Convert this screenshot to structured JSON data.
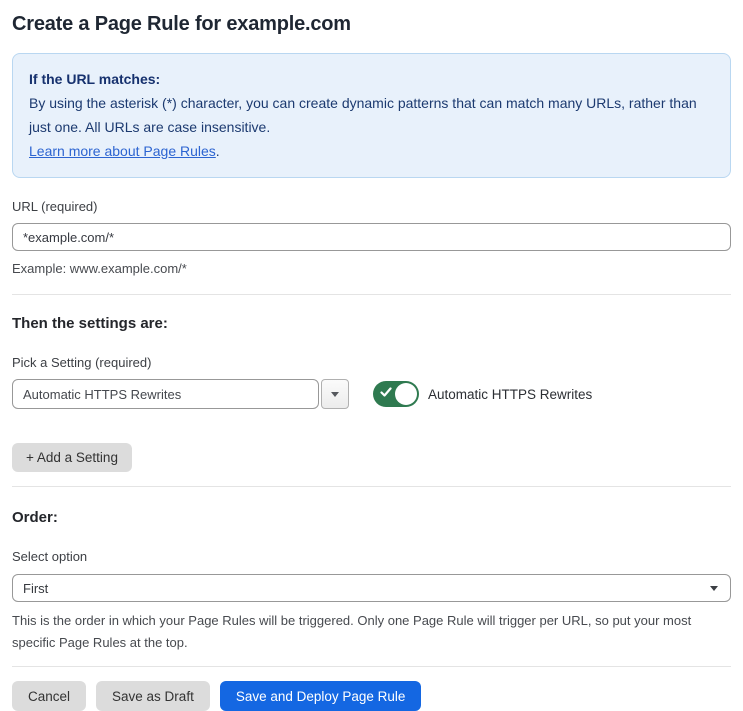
{
  "page": {
    "title": "Create a Page Rule for example.com"
  },
  "info_box": {
    "heading": "If the URL matches:",
    "body": "By using the asterisk (*) character, you can create dynamic patterns that can match many URLs, rather than just one. All URLs are case insensitive.",
    "link_label": "Learn more about Page Rules",
    "link_suffix": "."
  },
  "url_field": {
    "label": "URL (required)",
    "value": "*example.com/*",
    "helper": "Example: www.example.com/*"
  },
  "settings_section": {
    "heading": "Then the settings are:",
    "picker_label": "Pick a Setting (required)",
    "picker_value": "Automatic HTTPS Rewrites",
    "toggle": {
      "state": "on",
      "label": "Automatic HTTPS Rewrites"
    },
    "add_setting_label": "+ Add a Setting"
  },
  "order_section": {
    "heading": "Order:",
    "select_label": "Select option",
    "select_value": "First",
    "helper": "This is the order in which your Page Rules will be triggered. Only one Page Rule will trigger per URL, so put your most specific Page Rules at the top."
  },
  "footer": {
    "cancel_label": "Cancel",
    "save_draft_label": "Save as Draft",
    "save_deploy_label": "Save and Deploy Page Rule"
  },
  "colors": {
    "primary_blue": "#1467e2",
    "toggle_green": "#2f7a50",
    "info_box_bg": "#e8f1fb",
    "info_box_border": "#b9d7f1",
    "info_text": "#1c3a70",
    "link_blue": "#2c64d1",
    "gray_button_bg": "#dcdcdc"
  }
}
